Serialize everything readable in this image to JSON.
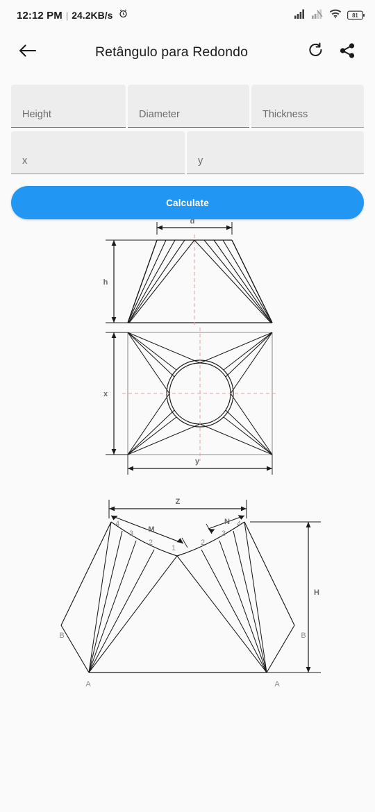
{
  "status_bar": {
    "time": "12:12 PM",
    "separator": "|",
    "network_speed": "24.2KB/s",
    "alarm_icon": "alarm-clock-icon",
    "signal_icon": "signal-bars-icon",
    "signal2_icon": "signal-bars-off-icon",
    "wifi_icon": "wifi-icon",
    "battery_level": "81"
  },
  "app_bar": {
    "back_icon": "back-arrow-icon",
    "title": "Retângulo para Redondo",
    "refresh_icon": "refresh-icon",
    "share_icon": "share-icon"
  },
  "form": {
    "fields": [
      {
        "name": "height",
        "placeholder": "Height",
        "value": ""
      },
      {
        "name": "diameter",
        "placeholder": "Diameter",
        "value": ""
      },
      {
        "name": "thickness",
        "placeholder": "Thickness",
        "value": ""
      },
      {
        "name": "x",
        "placeholder": "x",
        "value": ""
      },
      {
        "name": "y",
        "placeholder": "y",
        "value": ""
      }
    ],
    "calculate_label": "Calculate"
  },
  "colors": {
    "accent": "#2196f3",
    "page_bg": "#fafafa",
    "field_bg": "#ededed",
    "centerline": "#e8a0a0",
    "stroke": "#1a1a1a",
    "label": "#8d8d8d"
  },
  "diagrams": {
    "front_view": {
      "name": "front-elevation-trapezoid",
      "labels": {
        "top_dim": "d",
        "left_dim": "h"
      }
    },
    "plan_view": {
      "name": "plan-view-rectangle-circle",
      "labels": {
        "left_dim": "x",
        "bottom_dim": "y"
      }
    },
    "development": {
      "name": "flat-pattern-development",
      "labels": {
        "span": "Z",
        "chord_left": "M",
        "chord_right": "N",
        "height": "H",
        "corner_left": "A",
        "corner_right": "A",
        "side_left": "B",
        "side_right": "B",
        "points_left": [
          "1",
          "2",
          "3",
          "4"
        ],
        "points_right": [
          "1",
          "2",
          "3",
          "4"
        ]
      }
    }
  }
}
